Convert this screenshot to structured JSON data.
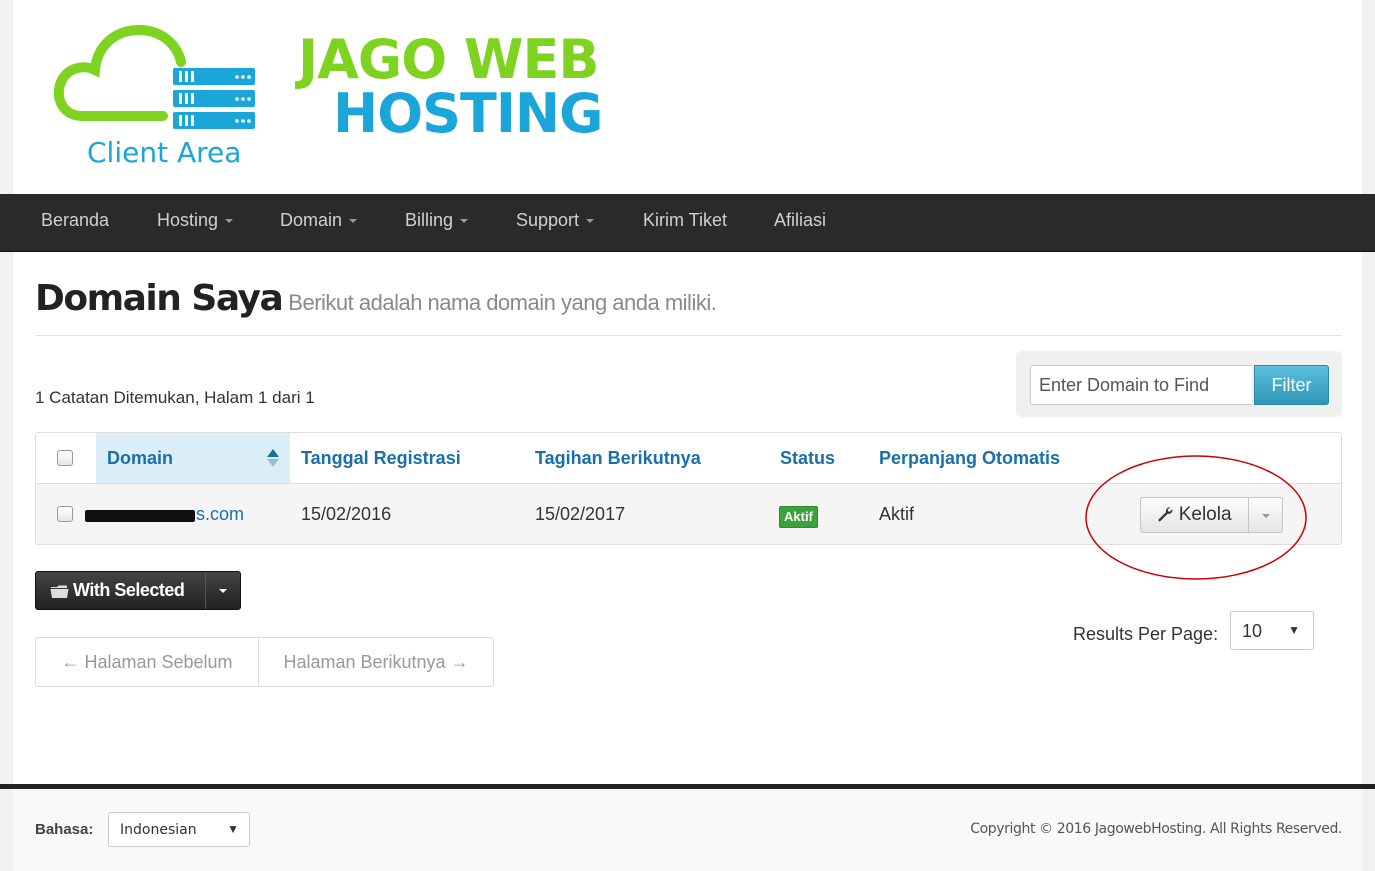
{
  "brand": {
    "title_line1": "JAGO WEB",
    "title_line2": "HOSTING",
    "subtitle": "Client Area",
    "colors": {
      "green": "#7ed321",
      "blue": "#1aa6d9"
    }
  },
  "nav": {
    "items": [
      {
        "label": "Beranda",
        "dropdown": false
      },
      {
        "label": "Hosting",
        "dropdown": true
      },
      {
        "label": "Domain",
        "dropdown": true
      },
      {
        "label": "Billing",
        "dropdown": true
      },
      {
        "label": "Support",
        "dropdown": true
      },
      {
        "label": "Kirim Tiket",
        "dropdown": false
      },
      {
        "label": "Afiliasi",
        "dropdown": false
      }
    ]
  },
  "page": {
    "title": "Domain Saya",
    "subtitle": "Berikut adalah nama domain yang anda miliki."
  },
  "records_info": "1 Catatan Ditemukan, Halam 1 dari 1",
  "filter": {
    "placeholder": "Enter Domain to Find",
    "button": "Filter"
  },
  "table": {
    "columns": [
      "Domain",
      "Tanggal Registrasi",
      "Tagihan Berikutnya",
      "Status",
      "Perpanjang Otomatis"
    ],
    "rows": [
      {
        "domain": "s.com",
        "registered": "15/02/2016",
        "next_due": "15/02/2017",
        "status": "Aktif",
        "auto_renew": "Aktif",
        "action": "Kelola"
      }
    ]
  },
  "bulk": {
    "label": "With Selected"
  },
  "pagination": {
    "prev": "← Halaman Sebelum",
    "next": "Halaman Berikutnya →"
  },
  "results_per_page": {
    "label": "Results Per Page:",
    "value": "10"
  },
  "footer": {
    "language_label": "Bahasa:",
    "language_value": "Indonesian",
    "copyright": "Copyright © 2016 JagowebHosting. All Rights Reserved."
  },
  "icons": {
    "logo": "cloud-server-icon",
    "sort": "sort-icon",
    "wrench": "wrench-icon",
    "folder": "folder-icon"
  },
  "status_color": "#3aa33a",
  "annotation_color": "#cc0000"
}
